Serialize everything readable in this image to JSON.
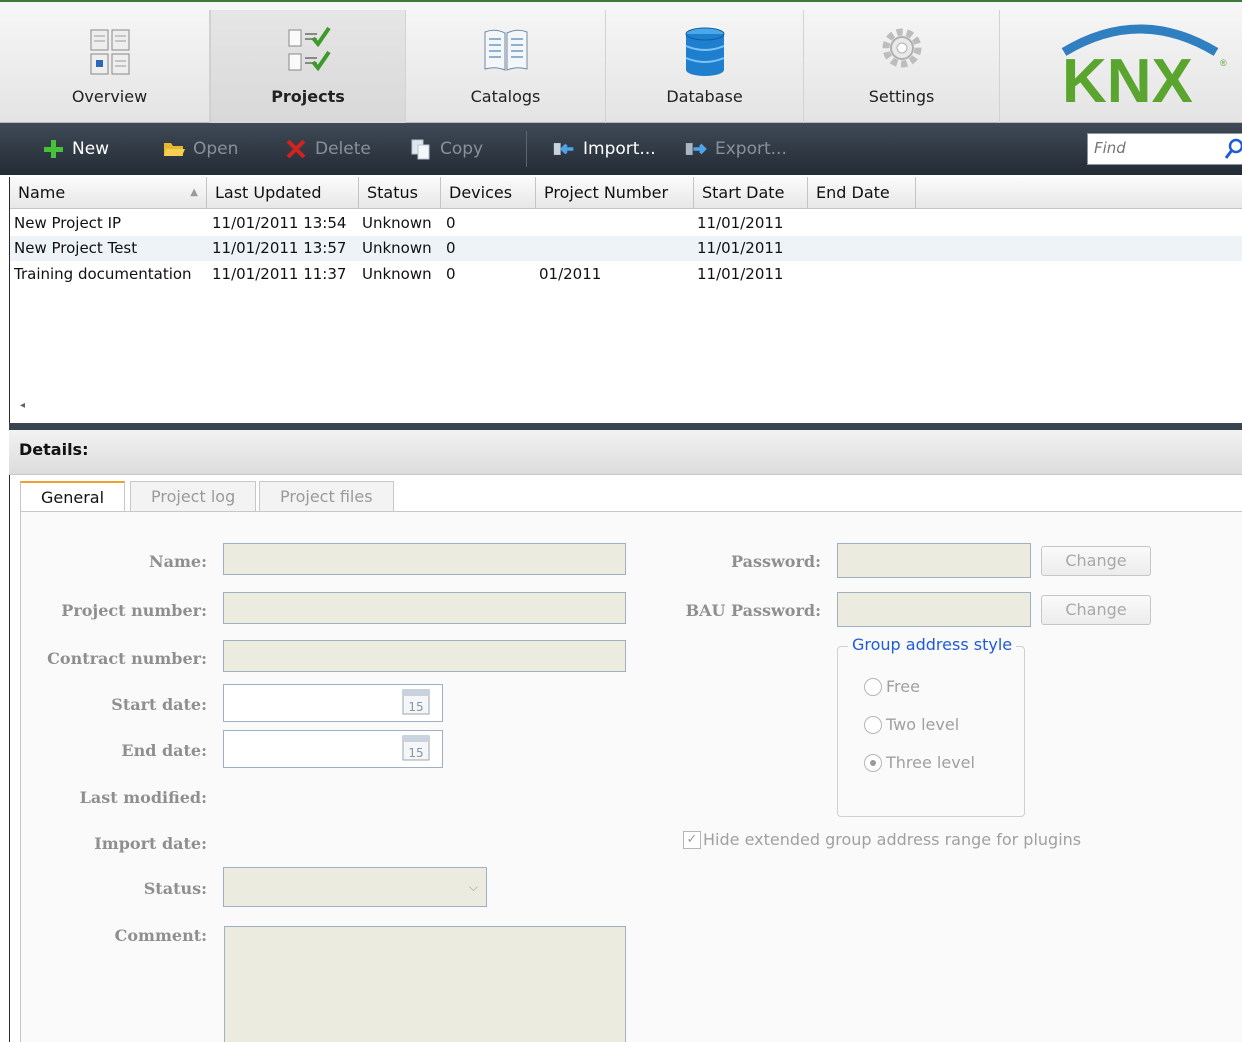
{
  "nav": {
    "tabs": [
      {
        "label": "Overview",
        "icon": "overview-icon"
      },
      {
        "label": "Projects",
        "icon": "projects-icon",
        "active": true
      },
      {
        "label": "Catalogs",
        "icon": "catalogs-icon"
      },
      {
        "label": "Database",
        "icon": "database-icon"
      },
      {
        "label": "Settings",
        "icon": "gear-icon"
      }
    ],
    "logo_text": "KNX"
  },
  "toolbar": {
    "new_label": "New",
    "open_label": "Open",
    "delete_label": "Delete",
    "copy_label": "Copy",
    "import_label": "Import...",
    "export_label": "Export...",
    "find_placeholder": "Find"
  },
  "grid": {
    "columns": [
      "Name",
      "Last Updated",
      "Status",
      "Devices",
      "Project Number",
      "Start Date",
      "End Date"
    ],
    "rows": [
      {
        "name": "New Project IP",
        "last_updated": "11/01/2011 13:54",
        "status": "Unknown",
        "devices": "0",
        "project_number": "",
        "start_date": "11/01/2011",
        "end_date": ""
      },
      {
        "name": "New Project Test",
        "last_updated": "11/01/2011 13:57",
        "status": "Unknown",
        "devices": "0",
        "project_number": "",
        "start_date": "11/01/2011",
        "end_date": ""
      },
      {
        "name": "Training documentation",
        "last_updated": "11/01/2011 11:37",
        "status": "Unknown",
        "devices": "0",
        "project_number": "01/2011",
        "start_date": "11/01/2011",
        "end_date": ""
      }
    ]
  },
  "details": {
    "title": "Details:",
    "tabs": [
      "General",
      "Project log",
      "Project files"
    ],
    "fields": {
      "name_label": "Name:",
      "project_number_label": "Project number:",
      "contract_number_label": "Contract number:",
      "start_date_label": "Start date:",
      "end_date_label": "End date:",
      "last_modified_label": "Last modified:",
      "import_date_label": "Import date:",
      "status_label": "Status:",
      "comment_label": "Comment:",
      "password_label": "Password:",
      "bau_password_label": "BAU Password:",
      "change_label": "Change",
      "calendar_day": "15"
    },
    "group_address_style": {
      "title": "Group address style",
      "options": [
        "Free",
        "Two level",
        "Three level"
      ],
      "selected": "Three level"
    },
    "hide_extended_label": "Hide extended group address range for plugins",
    "hide_extended_checked": true
  },
  "colors": {
    "toolbar": "#2f3843",
    "accent_tab": "#f0a030",
    "group_title": "#1f5bd6",
    "input_bg": "#ecebe0"
  }
}
